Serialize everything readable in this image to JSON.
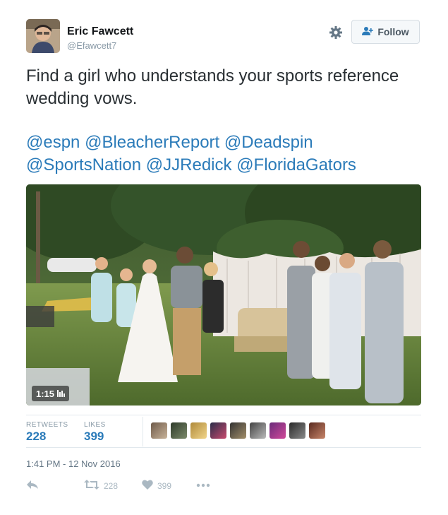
{
  "user": {
    "name": "Eric Fawcett",
    "handle": "@Efawcett7"
  },
  "follow_label": "Follow",
  "tweet": {
    "text": "Find a girl who understands your sports reference wedding vows.",
    "mentions": [
      "@espn",
      "@BleacherReport",
      "@Deadspin",
      "@SportsNation",
      "@JJRedick",
      "@FloridaGators"
    ]
  },
  "video": {
    "duration": "1:15"
  },
  "stats": {
    "retweets_label": "RETWEETS",
    "retweets_value": "228",
    "likes_label": "LIKES",
    "likes_value": "399"
  },
  "timestamp": "1:41 PM - 12 Nov 2016",
  "actions": {
    "retweet_count": "228",
    "like_count": "399"
  },
  "colors": {
    "link": "#2b7bb9",
    "muted": "#8899a6",
    "divider": "#e1e8ed"
  },
  "icons": [
    "gear-icon",
    "follow-person-icon",
    "reply-icon",
    "retweet-icon",
    "heart-icon",
    "more-icon",
    "video-bars-icon"
  ]
}
